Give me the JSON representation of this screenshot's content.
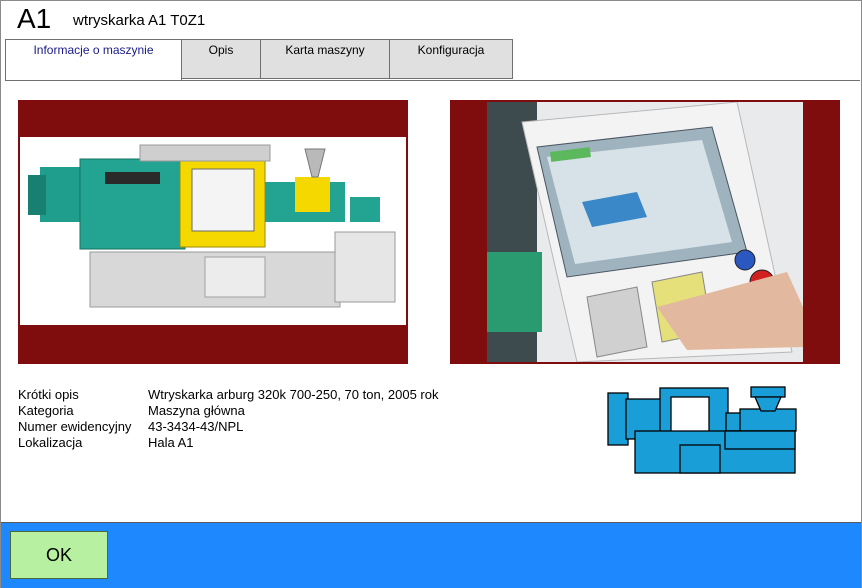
{
  "window": {
    "code": "A1",
    "name": "wtryskarka A1  T0Z1"
  },
  "tabs": [
    {
      "label": "Informacje o maszynie",
      "active": true
    },
    {
      "label": "Opis",
      "active": false
    },
    {
      "label": "Karta maszyny",
      "active": false
    },
    {
      "label": "Konfiguracja",
      "active": false
    }
  ],
  "images": {
    "machine_photo_icon": "injection-molding-machine-photo",
    "panel_photo_icon": "control-panel-photo",
    "machine_symbol_icon": "injection-machine-symbol-icon"
  },
  "info": [
    {
      "label": "Krótki opis",
      "value": "Wtryskarka arburg 320k 700-250, 70 ton, 2005 rok"
    },
    {
      "label": "Kategoria",
      "value": "Maszyna główna"
    },
    {
      "label": "Numer ewidencyjny",
      "value": "43-3434-43/NPL"
    },
    {
      "label": "Lokalizacja",
      "value": "Hala A1"
    }
  ],
  "footer": {
    "ok_label": "OK"
  },
  "colors": {
    "frame": "#7f0d0d",
    "footer": "#1e88ff",
    "ok_button": "#b7f0a0",
    "symbol": "#1a9ed8"
  }
}
